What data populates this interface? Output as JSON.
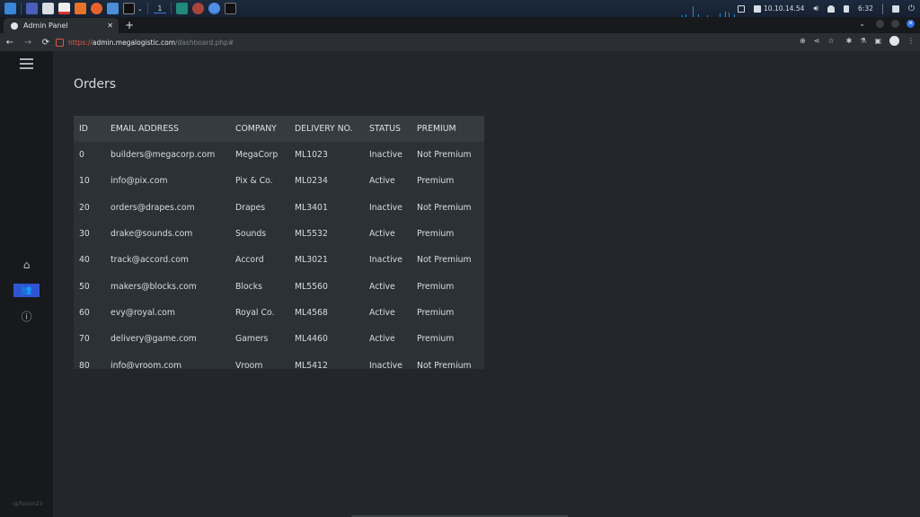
{
  "taskbar": {
    "workspace": "1",
    "ip_address": "10.10.14.54",
    "clock": "6:32",
    "icons": [
      "kali-menu-icon",
      "desktop-icon",
      "file-manager-icon",
      "text-editor-icon",
      "burp-icon",
      "firefox-icon",
      "terminal-blue-icon",
      "terminal-icon",
      "dropdown-icon",
      "app-teal-icon",
      "app-ruby-icon",
      "chromium-icon",
      "terminal-window-icon"
    ]
  },
  "browser": {
    "tab_title": "Admin Panel",
    "new_tab_label": "+",
    "url_scheme": "https://",
    "url_host": "admin.megalogistic.com",
    "url_path": "/dashboard.php#",
    "back_glyph": "←",
    "forward_glyph": "→",
    "reload_glyph": "⟳",
    "close_tab_glyph": "✕"
  },
  "sidebar": {
    "items": [
      {
        "name": "home",
        "glyph": "⌂",
        "active": false
      },
      {
        "name": "users",
        "glyph": "👥",
        "active": true
      },
      {
        "name": "info",
        "glyph": "ⓘ",
        "active": false
      }
    ],
    "footer": "qpfusion23"
  },
  "page": {
    "title": "Orders"
  },
  "table": {
    "columns": [
      "ID",
      "EMAIL ADDRESS",
      "COMPANY",
      "DELIVERY NO.",
      "STATUS",
      "PREMIUM"
    ],
    "rows": [
      [
        "0",
        "builders@megacorp.com",
        "MegaCorp",
        "ML1023",
        "Inactive",
        "Not Premium"
      ],
      [
        "10",
        "info@pix.com",
        "Pix & Co.",
        "ML0234",
        "Active",
        "Premium"
      ],
      [
        "20",
        "orders@drapes.com",
        "Drapes",
        "ML3401",
        "Inactive",
        "Not Premium"
      ],
      [
        "30",
        "drake@sounds.com",
        "Sounds",
        "ML5532",
        "Active",
        "Premium"
      ],
      [
        "40",
        "track@accord.com",
        "Accord",
        "ML3021",
        "Inactive",
        "Not Premium"
      ],
      [
        "50",
        "makers@blocks.com",
        "Blocks",
        "ML5560",
        "Active",
        "Premium"
      ],
      [
        "60",
        "evy@royal.com",
        "Royal Co.",
        "ML4568",
        "Active",
        "Premium"
      ],
      [
        "70",
        "delivery@game.com",
        "Gamers",
        "ML4460",
        "Active",
        "Premium"
      ],
      [
        "80",
        "info@vroom.com",
        "Vroom",
        "ML5412",
        "Inactive",
        "Not Premium"
      ]
    ]
  },
  "colors": {
    "accent": "#2f55d4",
    "sidebar_bg": "#17191c",
    "main_bg": "#23272b",
    "table_bg": "#2c3136",
    "table_header_bg": "#353b41"
  }
}
